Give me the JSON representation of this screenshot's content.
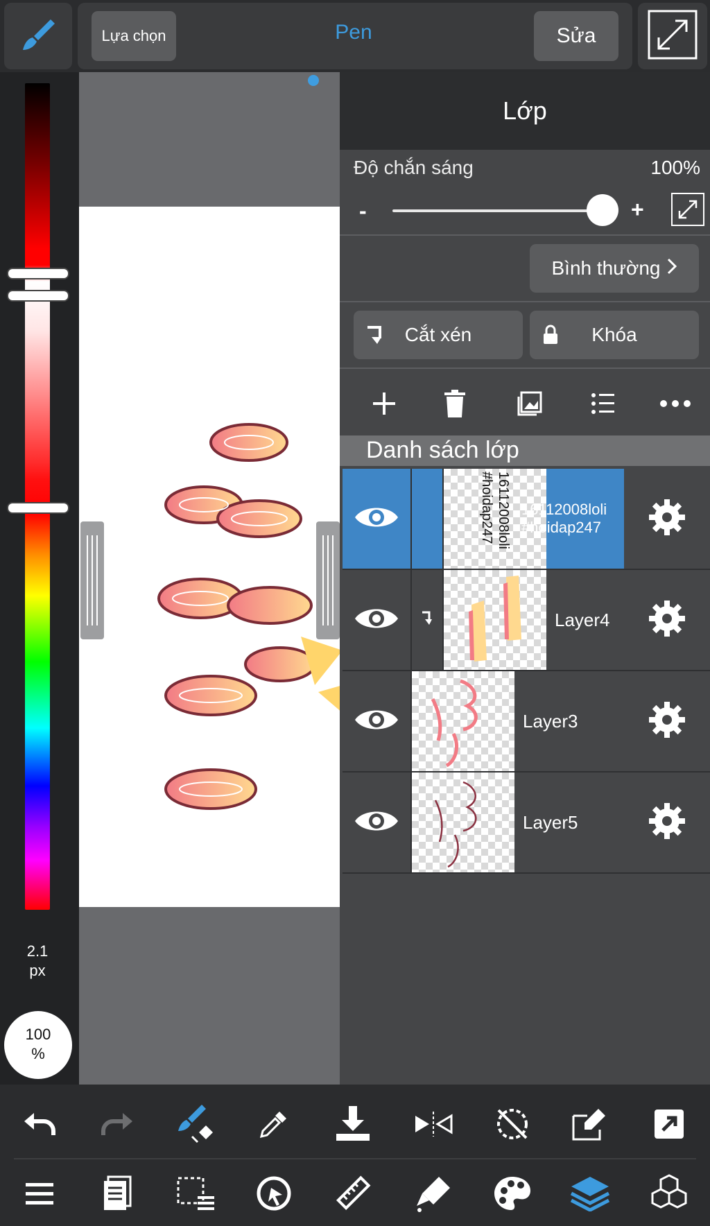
{
  "colors": {
    "accent": "#3d9bde",
    "panel": "#454648",
    "toolbar": "#2b2c2e",
    "active_row": "#3f86c6"
  },
  "topbar": {
    "brush_icon": "brush-icon",
    "select_label": "Lựa chọn",
    "tool_title": "Pen",
    "edit_label": "Sửa",
    "expand_icon": "expand-icon"
  },
  "left_panel": {
    "brush_size": "2.1",
    "brush_size_unit": "px",
    "opacity_value": "100",
    "opacity_unit": "%"
  },
  "layer_panel": {
    "title": "Lớp",
    "opacity_label": "Độ chắn sáng",
    "opacity_value": "100%",
    "opacity_level": 1.0,
    "minus_label": "-",
    "plus_label": "+",
    "blend_mode": "Bình thường",
    "clip_label": "Cắt xén",
    "lock_label": "Khóa",
    "actions": [
      "add-layer-icon",
      "trash-icon",
      "image-layer-icon",
      "list-icon",
      "more-icon"
    ],
    "list_title": "Danh sách lớp",
    "layers": [
      {
        "name_line1": "16112008loli",
        "name_line2": "#hoidap247",
        "thumb_text1": "16112008loli",
        "thumb_text2": "#hoidap247",
        "visible": true,
        "active": true,
        "clipped": false
      },
      {
        "name": "Layer4",
        "visible": true,
        "active": false,
        "clipped": true
      },
      {
        "name": "Layer3",
        "visible": true,
        "active": false,
        "clipped": false
      },
      {
        "name": "Layer5",
        "visible": true,
        "active": false,
        "clipped": false
      }
    ]
  },
  "bottom_toolbar": {
    "row1": [
      "undo-icon",
      "redo-icon",
      "brush-transform-icon",
      "eyedropper-icon",
      "save-download-icon",
      "flip-icon",
      "rotate-off-icon",
      "edit-canvas-icon",
      "share-icon"
    ],
    "row2": [
      "menu-icon",
      "pages-icon",
      "selection-icon",
      "snap-icon",
      "ruler-icon",
      "fill-icon",
      "palette-icon",
      "layers-icon",
      "materials-icon"
    ]
  }
}
